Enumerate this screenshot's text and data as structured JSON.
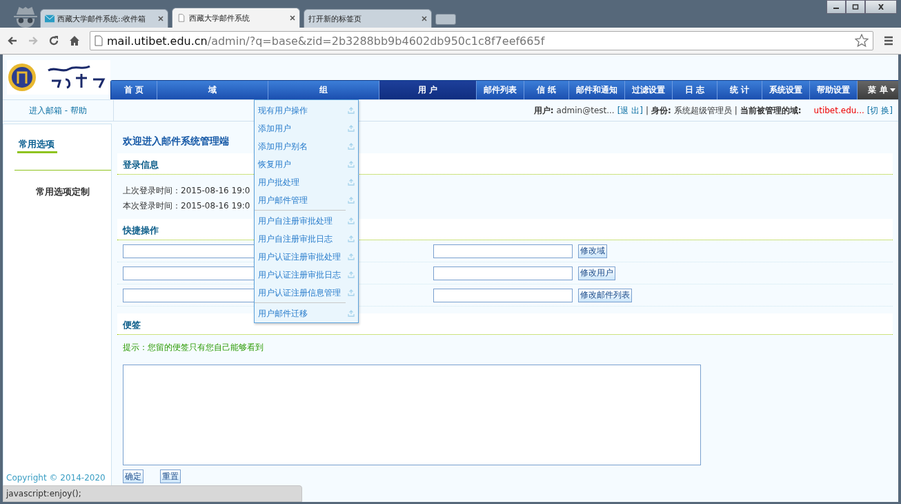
{
  "browser": {
    "tabs": [
      {
        "title": "西藏大学邮件系统::收件箱",
        "selected": false,
        "kind": "mail"
      },
      {
        "title": "西藏大学邮件系统",
        "selected": true,
        "kind": "page"
      },
      {
        "title": "打开新的标签页",
        "selected": false,
        "kind": "blank"
      }
    ],
    "address": {
      "host": "mail.utibet.edu.cn",
      "path": "/admin/?q=base&zid=2b3288bb9b4602db950c1c8f7eef665f"
    },
    "status_text": "javascript:enjoy();"
  },
  "nav": [
    {
      "label": "首 页",
      "selected": false,
      "kind": "item"
    },
    {
      "label": "域",
      "selected": false,
      "kind": "item"
    },
    {
      "label": "组",
      "selected": false,
      "kind": "item"
    },
    {
      "label": "用 户",
      "selected": true,
      "kind": "item"
    },
    {
      "label": "邮件列表",
      "selected": false,
      "kind": "item"
    },
    {
      "label": "信 纸",
      "selected": false,
      "kind": "item"
    },
    {
      "label": "邮件和通知",
      "selected": false,
      "kind": "item"
    },
    {
      "label": "过滤设置",
      "selected": false,
      "kind": "item"
    },
    {
      "label": "日 志",
      "selected": false,
      "kind": "item"
    },
    {
      "label": "统 计",
      "selected": false,
      "kind": "item"
    },
    {
      "label": "系统设置",
      "selected": false,
      "kind": "item"
    },
    {
      "label": "帮助设置",
      "selected": false,
      "kind": "item"
    },
    {
      "label": "菜 单",
      "selected": false,
      "kind": "menu"
    }
  ],
  "top_links": "进入邮箱 - 帮助",
  "user_bar": {
    "user_label": "用户:",
    "user": "admin@test...",
    "logout": "[退 出]",
    "separator": "|",
    "role_label": "身份:",
    "role": "系统超级管理员",
    "separator_2": "|",
    "domain_label": "当前被管理的域:",
    "domain": "utibet.edu...",
    "switch": "[切 换]"
  },
  "sidebar": {
    "tab": "常用选项",
    "items": [
      "常用选项定制"
    ],
    "copyright": "Copyright © 2014-2020"
  },
  "main": {
    "welcome": "欢迎进入邮件系统管理端",
    "login": {
      "title": "登录信息",
      "lines": [
        "上次登录时间：2015-08-16 19:0",
        "本次登录时间：2015-08-16 19:0"
      ]
    },
    "quick": {
      "title": "快捷操作",
      "rows": [
        {
          "button": "修改域"
        },
        {
          "button": "修改用户"
        },
        {
          "button": "修改邮件列表"
        }
      ]
    },
    "notes": {
      "title": "便签",
      "hint": "提示：您留的便签只有您自己能够看到",
      "buttons": [
        "确定",
        "重置"
      ]
    }
  },
  "dropdown": {
    "groups": [
      [
        "现有用户操作",
        "添加用户",
        "添加用户别名",
        "恢复用户",
        "用户批处理",
        "用户邮件管理"
      ],
      [
        "用户自注册审批处理",
        "用户自注册审批日志",
        "用户认证注册审批处理",
        "用户认证注册审批日志",
        "用户认证注册信息管理"
      ],
      [
        "用户邮件迁移"
      ]
    ]
  }
}
